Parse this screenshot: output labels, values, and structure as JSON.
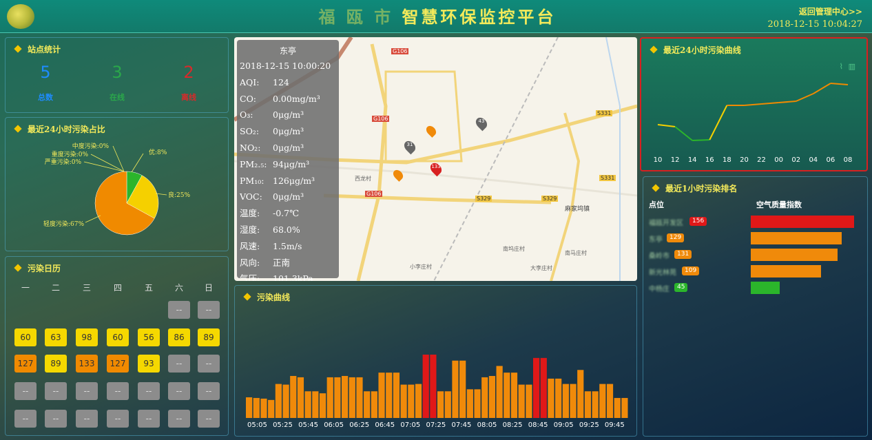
{
  "header": {
    "title_prefix": "福 瓯 市",
    "title": "智慧环保监控平台",
    "back_link": "返回管理中心>>",
    "datetime": "2018-12-15 10:04:27"
  },
  "station_stats": {
    "title": "站点统计",
    "items": [
      {
        "value": "5",
        "label": "总数",
        "color": "#1e8cff"
      },
      {
        "value": "3",
        "label": "在线",
        "color": "#2aa84a"
      },
      {
        "value": "2",
        "label": "离线",
        "color": "#d82a2a"
      }
    ]
  },
  "pollution_ratio": {
    "title": "最近24小时污染占比",
    "chart_data": {
      "type": "pie",
      "categories": [
        "优",
        "良",
        "轻度污染",
        "中度污染",
        "重度污染",
        "严重污染"
      ],
      "values": [
        8,
        25,
        67,
        0,
        0,
        0
      ],
      "labels": [
        "优:8%",
        "良:25%",
        "轻度污染:67%",
        "中度污染:0%",
        "重度污染:0%",
        "严重污染:0%"
      ],
      "colors": [
        "#2bb52b",
        "#f5d000",
        "#f08a00",
        "#e02020",
        "#a02080",
        "#7a1010"
      ]
    }
  },
  "calendar": {
    "title": "污染日历",
    "weekdays": [
      "一",
      "二",
      "三",
      "四",
      "五",
      "六",
      "日"
    ],
    "cells": [
      [
        "",
        "",
        "",
        "",
        "",
        "--",
        "--"
      ],
      [
        "60",
        "63",
        "98",
        "60",
        "56",
        "86",
        "89"
      ],
      [
        "127",
        "89",
        "133",
        "127",
        "93",
        "--",
        "--"
      ],
      [
        "--",
        "--",
        "--",
        "--",
        "--",
        "--",
        "--"
      ],
      [
        "--",
        "--",
        "--",
        "--",
        "--",
        "--",
        "--"
      ]
    ]
  },
  "map_info": {
    "header": "东亭",
    "time": "2018-12-15 10:00:20",
    "rows": [
      {
        "k": "AQI:",
        "v": "124"
      },
      {
        "k": "CO:",
        "v": "0.00mg/m³"
      },
      {
        "k": "O₃:",
        "v": "0μg/m³"
      },
      {
        "k": "SO₂:",
        "v": "0μg/m³"
      },
      {
        "k": "NO₂:",
        "v": "0μg/m³"
      },
      {
        "k": "PM₂.₅:",
        "v": "94μg/m³"
      },
      {
        "k": "PM₁₀:",
        "v": "126μg/m³"
      },
      {
        "k": "VOC:",
        "v": "0μg/m³"
      },
      {
        "k": "温度:",
        "v": "-0.7℃"
      },
      {
        "k": "湿度:",
        "v": "68.0%"
      },
      {
        "k": "风速:",
        "v": "1.5m/s"
      },
      {
        "k": "风向:",
        "v": "正南"
      },
      {
        "k": "气压:",
        "v": "101.3kPa"
      }
    ],
    "map_labels": [
      "G106",
      "G106",
      "G106",
      "S329",
      "S329",
      "S331",
      "S331",
      "麻家坞镇",
      "南坞庄村",
      "大李庄村",
      "小李庄村",
      "西龙村",
      "南马庄村"
    ],
    "markers": [
      {
        "label": "43",
        "color": "#666"
      },
      {
        "label": "31",
        "color": "#666"
      },
      {
        "label": "133",
        "color": "#d82020"
      }
    ]
  },
  "pollution_curve": {
    "title": "污染曲线",
    "chart_data": {
      "type": "bar",
      "tick_labels": [
        "05:05",
        "05:25",
        "05:45",
        "06:05",
        "06:25",
        "06:45",
        "07:05",
        "07:25",
        "07:45",
        "08:05",
        "08:25",
        "08:45",
        "09:05",
        "09:25",
        "09:45"
      ],
      "values": [
        31,
        30,
        29,
        27,
        51,
        50,
        63,
        61,
        40,
        40,
        37,
        61,
        61,
        63,
        61,
        61,
        40,
        40,
        68,
        68,
        68,
        50,
        50,
        51,
        95,
        95,
        40,
        40,
        86,
        86,
        43,
        43,
        61,
        63,
        78,
        68,
        68,
        50,
        50,
        90,
        90,
        59,
        59,
        51,
        51,
        72,
        40,
        40,
        51,
        51,
        30,
        30
      ],
      "colors": {
        "normal": "#f08a0a",
        "high": "#e01818"
      },
      "high_threshold": 90
    }
  },
  "curve_24h": {
    "title": "最近24小时污染曲线",
    "chart_data": {
      "type": "line",
      "x": [
        "10",
        "12",
        "14",
        "16",
        "18",
        "20",
        "22",
        "00",
        "02",
        "04",
        "06",
        "08"
      ],
      "y": [
        60,
        57,
        37,
        38,
        88,
        88,
        90,
        92,
        94,
        105,
        120,
        118
      ],
      "colors": {
        "good": "#2bb52b",
        "moderate": "#f5d000",
        "light": "#f08a00"
      }
    }
  },
  "ranking": {
    "title": "最近1小时污染排名",
    "col_point": "点位",
    "col_index": "空气质量指数",
    "items": [
      {
        "name": "福瓯开发区",
        "value": "156",
        "fill": 1.0,
        "color": "#e01818"
      },
      {
        "name": "东亭",
        "value": "129",
        "fill": 0.88,
        "color": "#f08a0a"
      },
      {
        "name": "桑岭市",
        "value": "131",
        "fill": 0.84,
        "color": "#f08a0a"
      },
      {
        "name": "新光林苑",
        "value": "109",
        "fill": 0.68,
        "color": "#f08a0a"
      },
      {
        "name": "中杨庄",
        "value": "45",
        "fill": 0.28,
        "color": "#2bb52b"
      }
    ]
  }
}
